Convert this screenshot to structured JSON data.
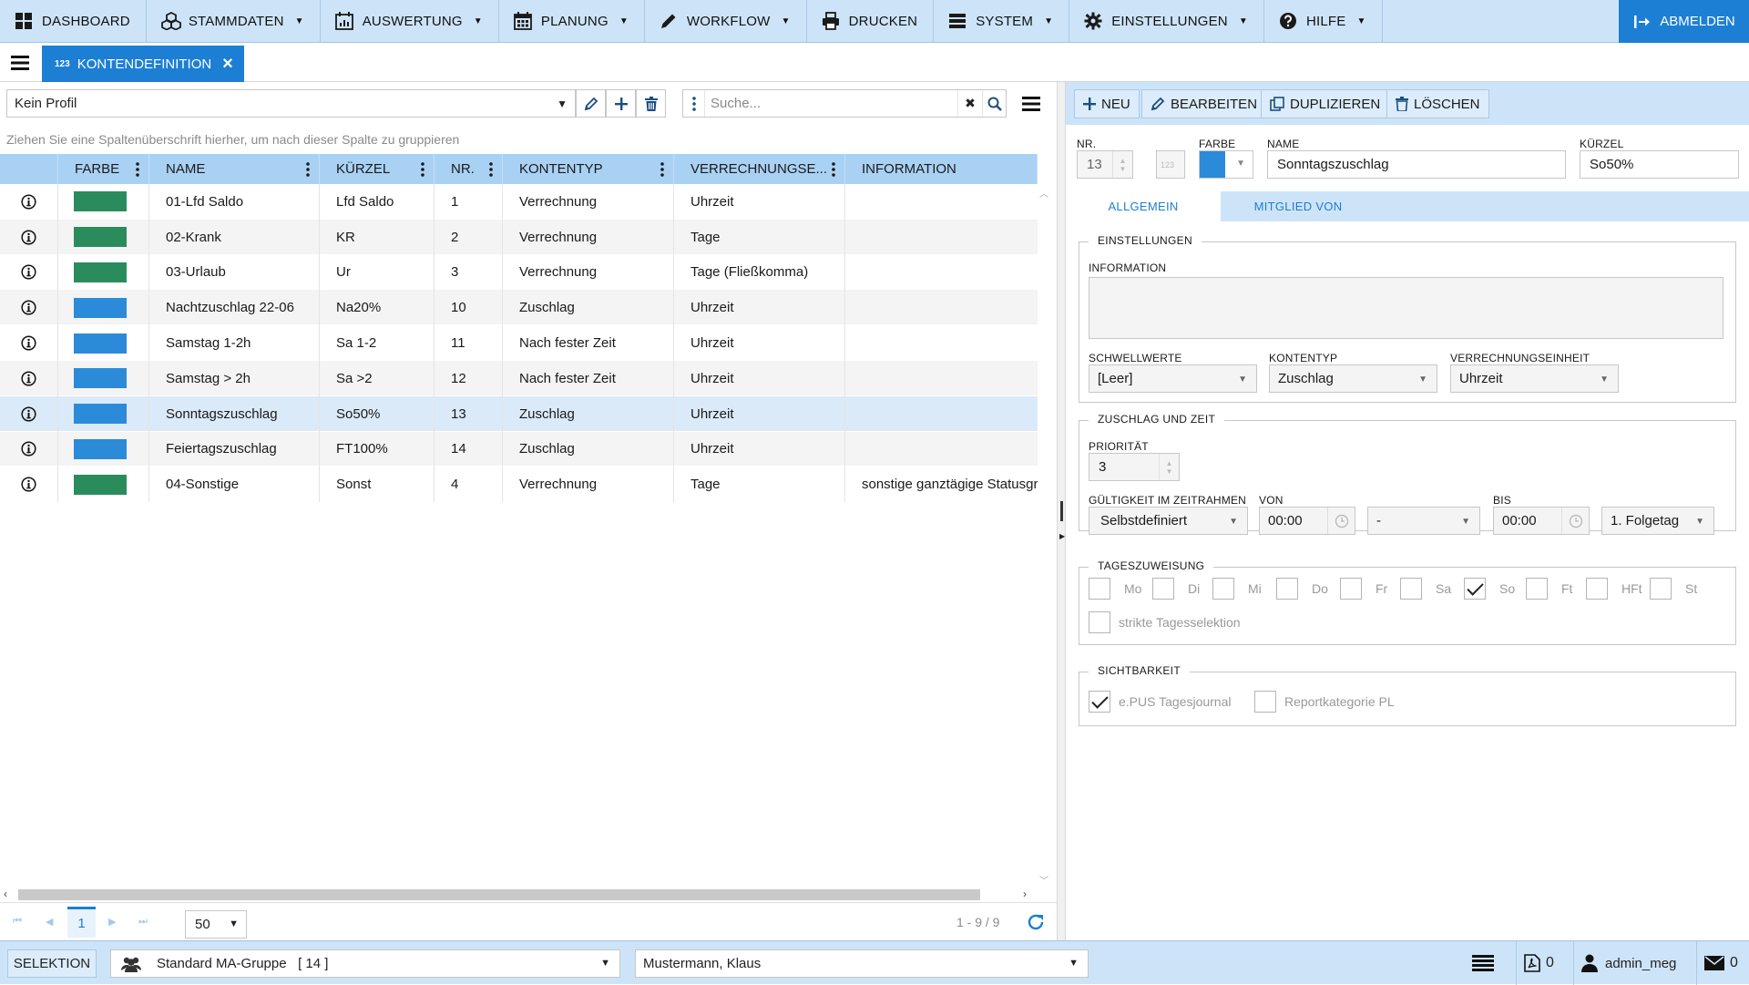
{
  "menu": {
    "items": [
      {
        "label": "DASHBOARD",
        "icon": "dashboard-grid-icon",
        "dropdown": false
      },
      {
        "label": "STAMMDATEN",
        "icon": "cubes-icon",
        "dropdown": true
      },
      {
        "label": "AUSWERTUNG",
        "icon": "calendar-chart-icon",
        "dropdown": true
      },
      {
        "label": "PLANUNG",
        "icon": "calendar-icon",
        "dropdown": true
      },
      {
        "label": "WORKFLOW",
        "icon": "pencil-icon",
        "dropdown": true
      },
      {
        "label": "DRUCKEN",
        "icon": "printer-icon",
        "dropdown": false
      },
      {
        "label": "SYSTEM",
        "icon": "server-icon",
        "dropdown": true
      },
      {
        "label": "EINSTELLUNGEN",
        "icon": "gear-icon",
        "dropdown": true
      },
      {
        "label": "HILFE",
        "icon": "help-circle-icon",
        "dropdown": true
      }
    ],
    "logout_label": "ABMELDEN"
  },
  "tab": {
    "badge": "123",
    "label": "KONTENDEFINITION"
  },
  "toolbar": {
    "profile_value": "Kein Profil",
    "search_placeholder": "Suche..."
  },
  "grid": {
    "group_hint": "Ziehen Sie eine Spaltenüberschrift hierher, um nach dieser Spalte zu gruppieren",
    "columns": [
      "FARBE",
      "NAME",
      "KÜRZEL",
      "NR.",
      "KONTENTYP",
      "VERRECHNUNGSE...",
      "INFORMATION"
    ],
    "rows": [
      {
        "color": "#2a8c5c",
        "name": "01-Lfd Saldo",
        "kuerzel": "Lfd Saldo",
        "nr": "1",
        "kontentyp": "Verrechnung",
        "verrechnung": "Uhrzeit",
        "info": ""
      },
      {
        "color": "#2a8c5c",
        "name": "02-Krank",
        "kuerzel": "KR",
        "nr": "2",
        "kontentyp": "Verrechnung",
        "verrechnung": "Tage",
        "info": ""
      },
      {
        "color": "#2a8c5c",
        "name": "03-Urlaub",
        "kuerzel": "Ur",
        "nr": "3",
        "kontentyp": "Verrechnung",
        "verrechnung": "Tage (Fließkomma)",
        "info": ""
      },
      {
        "color": "#2b8bd9",
        "name": "Nachtzuschlag 22-06",
        "kuerzel": "Na20%",
        "nr": "10",
        "kontentyp": "Zuschlag",
        "verrechnung": "Uhrzeit",
        "info": ""
      },
      {
        "color": "#2b8bd9",
        "name": "Samstag 1-2h",
        "kuerzel": "Sa 1-2",
        "nr": "11",
        "kontentyp": "Nach fester Zeit",
        "verrechnung": "Uhrzeit",
        "info": ""
      },
      {
        "color": "#2b8bd9",
        "name": "Samstag > 2h",
        "kuerzel": "Sa >2",
        "nr": "12",
        "kontentyp": "Nach fester Zeit",
        "verrechnung": "Uhrzeit",
        "info": ""
      },
      {
        "color": "#2b8bd9",
        "name": "Sonntagszuschlag",
        "kuerzel": "So50%",
        "nr": "13",
        "kontentyp": "Zuschlag",
        "verrechnung": "Uhrzeit",
        "info": ""
      },
      {
        "color": "#2b8bd9",
        "name": "Feiertagszuschlag",
        "kuerzel": "FT100%",
        "nr": "14",
        "kontentyp": "Zuschlag",
        "verrechnung": "Uhrzeit",
        "info": ""
      },
      {
        "color": "#2a8c5c",
        "name": "04-Sonstige",
        "kuerzel": "Sonst",
        "nr": "4",
        "kontentyp": "Verrechnung",
        "verrechnung": "Tage",
        "info": "sonstige ganztägige Statusgr"
      }
    ],
    "selected_row": 6
  },
  "pager": {
    "current_page": "1",
    "page_size": "50",
    "info": "1 - 9 / 9"
  },
  "detail": {
    "buttons": {
      "new": "NEU",
      "edit": "BEARBEITEN",
      "duplicate": "DUPLIZIEREN",
      "delete": "LÖSCHEN"
    },
    "nr_label": "NR.",
    "nr_value": "13",
    "nr_badge": "123",
    "color_label": "FARBE",
    "color_value": "#2b8bd9",
    "name_label": "NAME",
    "name_value": "Sonntagszuschlag",
    "kuerzel_label": "KÜRZEL",
    "kuerzel_value": "So50%",
    "tabs": [
      "ALLGEMEIN",
      "MITGLIED VON"
    ],
    "einstellungen": {
      "title": "EINSTELLUNGEN",
      "info_label": "INFORMATION",
      "info_value": "",
      "schwellwerte_label": "SCHWELLWERTE",
      "schwellwerte_value": "[Leer]",
      "kontentyp_label": "KONTENTYP",
      "kontentyp_value": "Zuschlag",
      "verrechnung_label": "VERRECHNUNGSEINHEIT",
      "verrechnung_value": "Uhrzeit"
    },
    "zuschlag": {
      "title": "ZUSCHLAG UND ZEIT",
      "prioritaet_label": "PRIORITÄT",
      "prioritaet_value": "3",
      "gueltigkeit_label": "GÜLTIGKEIT IM ZEITRAHMEN",
      "gueltigkeit_value": "Selbstdefiniert",
      "von_label": "VON",
      "von_value": "00:00",
      "von_day_value": "-",
      "bis_label": "BIS",
      "bis_value": "00:00",
      "bis_day_value": "1. Folgetag"
    },
    "tageszuweisung": {
      "title": "TAGESZUWEISUNG",
      "days": [
        {
          "label": "Mo",
          "checked": false
        },
        {
          "label": "Di",
          "checked": false
        },
        {
          "label": "Mi",
          "checked": false
        },
        {
          "label": "Do",
          "checked": false
        },
        {
          "label": "Fr",
          "checked": false
        },
        {
          "label": "Sa",
          "checked": false
        },
        {
          "label": "So",
          "checked": true
        },
        {
          "label": "Ft",
          "checked": false
        },
        {
          "label": "HFt",
          "checked": false
        },
        {
          "label": "St",
          "checked": false
        }
      ],
      "strict_label": "strikte Tagesselektion",
      "strict_checked": false
    },
    "sichtbarkeit": {
      "title": "SICHTBARKEIT",
      "items": [
        {
          "label": "e.PUS Tagesjournal",
          "checked": true
        },
        {
          "label": "Reportkategorie PL",
          "checked": false
        }
      ]
    }
  },
  "statusbar": {
    "selection_label": "SELEKTION",
    "group_value": "Standard MA-Gruppe   [ 14 ]",
    "person_value": "Mustermann, Klaus",
    "pdf_count": "0",
    "user": "admin_meg",
    "mail_count": "0"
  }
}
